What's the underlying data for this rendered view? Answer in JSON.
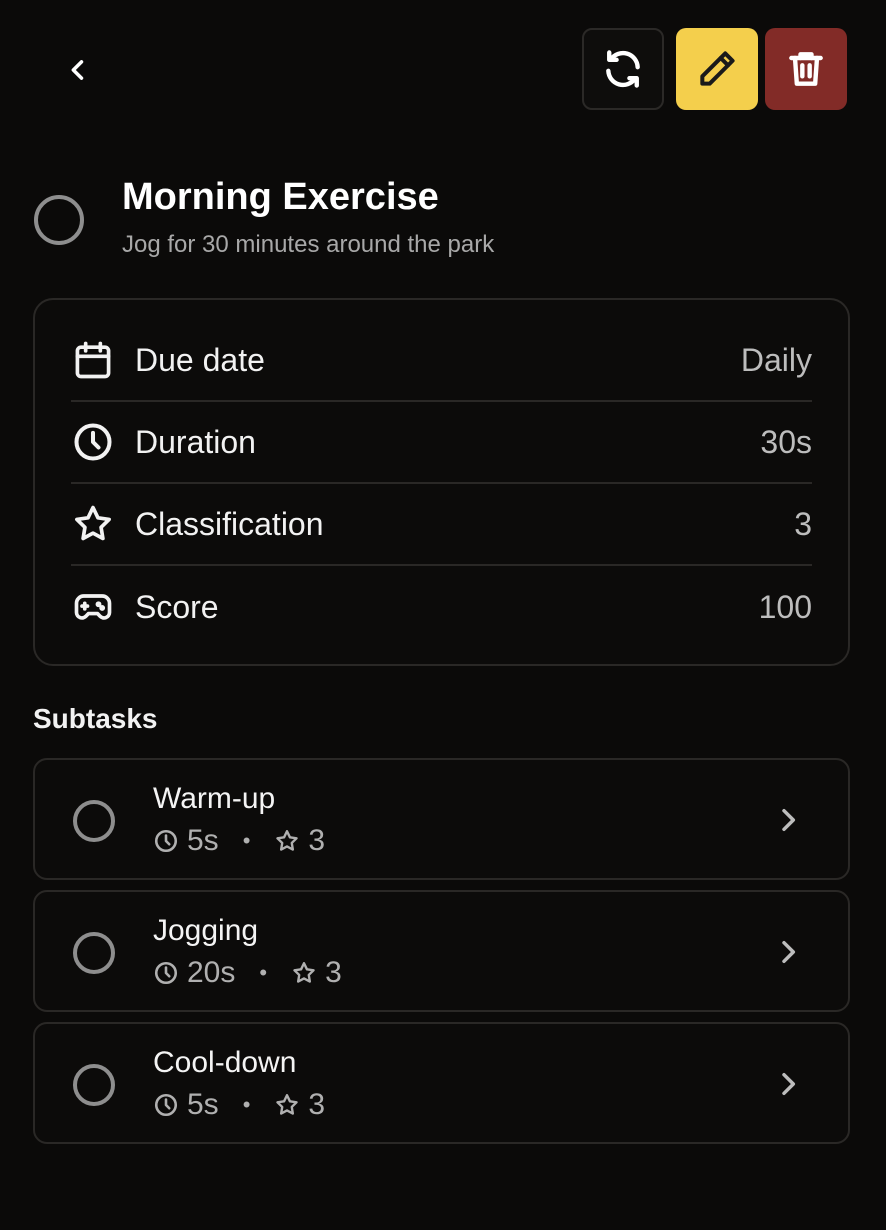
{
  "header": {
    "title": "Morning Exercise",
    "description": "Jog for 30 minutes around the park"
  },
  "toolbar": {
    "icons": [
      "chevron-left-icon",
      "repeat-icon",
      "pencil-icon",
      "trash-icon"
    ],
    "colors": {
      "edit": "#f4cf4c",
      "delete": "#822b27"
    }
  },
  "details": [
    {
      "icon": "calendar-icon",
      "label": "Due date",
      "value": "Daily"
    },
    {
      "icon": "clock-icon",
      "label": "Duration",
      "value": "30s"
    },
    {
      "icon": "star-icon",
      "label": "Classification",
      "value": "3"
    },
    {
      "icon": "gamepad-icon",
      "label": "Score",
      "value": "100"
    }
  ],
  "subtasks_heading": "Subtasks",
  "subtasks": [
    {
      "title": "Warm-up",
      "duration": "5s",
      "rating": "3"
    },
    {
      "title": "Jogging",
      "duration": "20s",
      "rating": "3"
    },
    {
      "title": "Cool-down",
      "duration": "5s",
      "rating": "3"
    }
  ],
  "meta_separator": "•"
}
